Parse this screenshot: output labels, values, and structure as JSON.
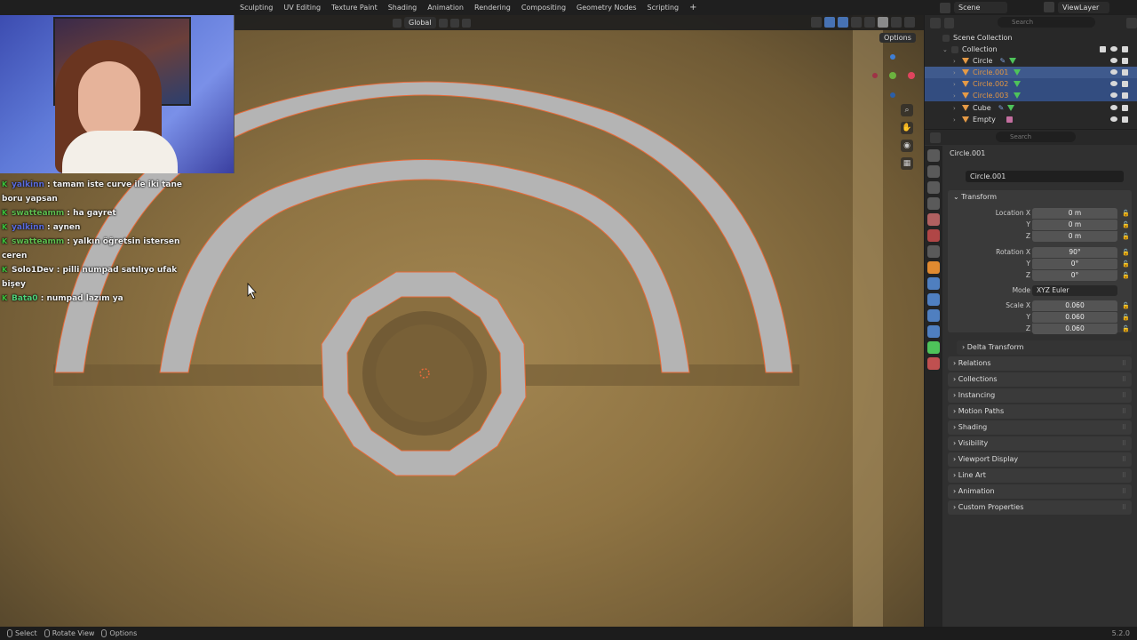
{
  "workspace_tabs": [
    "Sculpting",
    "UV Editing",
    "Texture Paint",
    "Shading",
    "Animation",
    "Rendering",
    "Compositing",
    "Geometry Nodes",
    "Scripting"
  ],
  "workspace_add": "+",
  "scene": {
    "label": "Scene",
    "view_layer": "ViewLayer",
    "search_placeholder": "Search"
  },
  "viewport": {
    "transform_orientation": "Global",
    "options_label": "Options"
  },
  "chat": [
    {
      "user": "yalkinn",
      "message": " : tamam iste curve ile iki tane boru yapsan",
      "user_color": "#5a6cdf"
    },
    {
      "user": "swatteamm",
      "message": " : ha gayret",
      "user_color": "#5fbf4f"
    },
    {
      "user": "yalkinn",
      "message": " : aynen",
      "user_color": "#5a6cdf"
    },
    {
      "user": "swatteamm",
      "message": " : yalkın öğretsin istersen ceren",
      "user_color": "#5fbf4f"
    },
    {
      "user": "Solo1Dev",
      "message": " : pilli numpad satılıyo ufak bişey",
      "user_color": "#f0f0f0"
    },
    {
      "user": "Bata0",
      "message": " : numpad lazım ya",
      "user_color": "#4fd37a"
    }
  ],
  "outliner": {
    "search_placeholder": "Search",
    "scene_collection": "Scene Collection",
    "collection": "Collection",
    "items": [
      {
        "name": "Circle",
        "selected": false,
        "active": false
      },
      {
        "name": "Circle.001",
        "selected": true,
        "active": true
      },
      {
        "name": "Circle.002",
        "selected": true,
        "active": false
      },
      {
        "name": "Circle.003",
        "selected": true,
        "active": false
      },
      {
        "name": "Cube",
        "selected": false,
        "active": false
      },
      {
        "name": "Empty",
        "selected": false,
        "active": false
      }
    ]
  },
  "properties": {
    "search_placeholder": "Search",
    "object_name": "Circle.001",
    "object_field": "Circle.001",
    "transform_title": "Transform",
    "location": {
      "label_x": "Location X",
      "x": "0 m",
      "y": "0 m",
      "z": "0 m"
    },
    "rotation": {
      "label_x": "Rotation X",
      "x": "90°",
      "y": "0°",
      "z": "0°"
    },
    "mode": {
      "label": "Mode",
      "value": "XYZ Euler"
    },
    "scale": {
      "label_x": "Scale X",
      "x": "0.060",
      "y": "0.060",
      "z": "0.060"
    },
    "axis_y": "Y",
    "axis_z": "Z",
    "delta_transform": "Delta Transform",
    "sections": [
      "Relations",
      "Collections",
      "Instancing",
      "Motion Paths",
      "Shading",
      "Visibility",
      "Viewport Display",
      "Line Art",
      "Animation",
      "Custom Properties"
    ]
  },
  "statusbar": {
    "select": "Select",
    "rotate": "Rotate View",
    "options": "Options",
    "version": "5.2.0"
  },
  "colors": {
    "accent_blue": "#4772b3",
    "selection_orange": "#e59a46",
    "mesh_gray": "#b4b4b4"
  }
}
